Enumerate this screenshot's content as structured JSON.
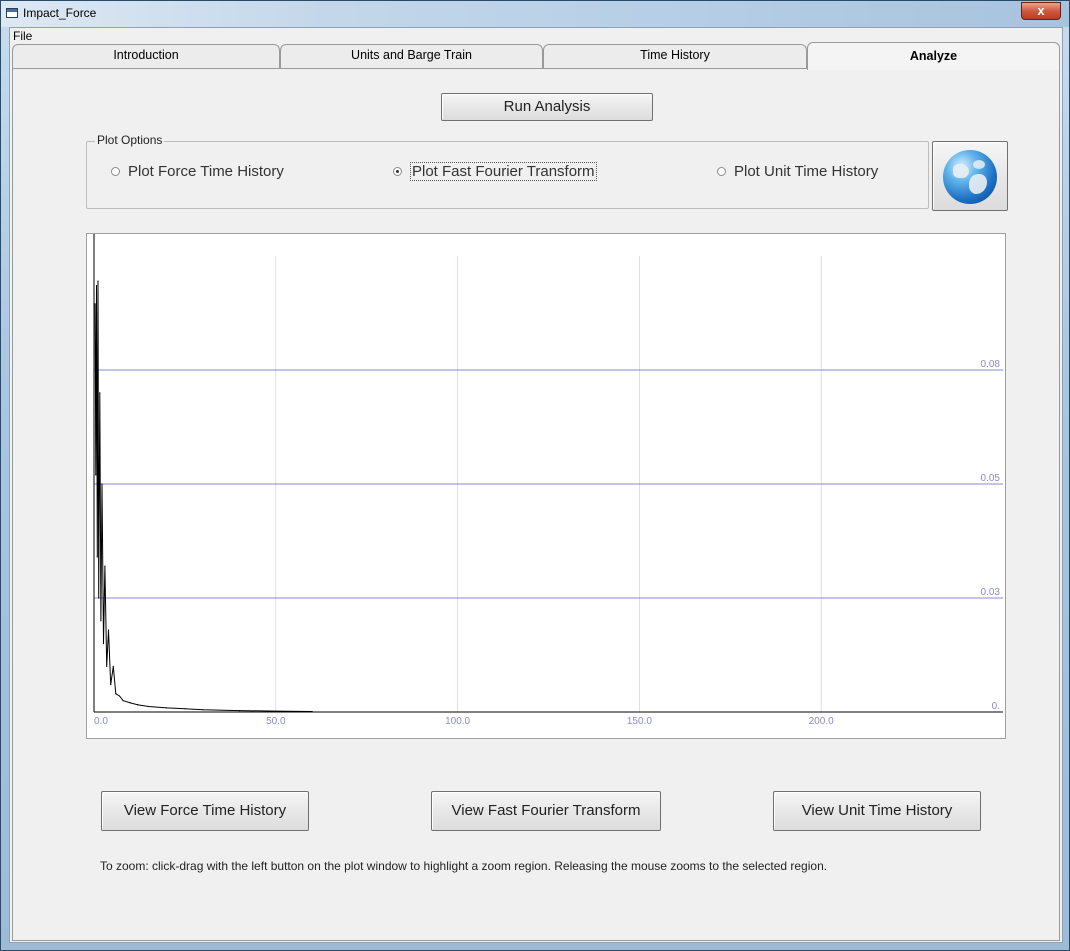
{
  "window": {
    "title": "Impact_Force",
    "close_label": "x"
  },
  "menu": {
    "file": "File"
  },
  "tabs": [
    {
      "label": "Introduction",
      "active": false
    },
    {
      "label": "Units and Barge Train",
      "active": false
    },
    {
      "label": "Time History",
      "active": false
    },
    {
      "label": "Analyze",
      "active": true
    }
  ],
  "run_button": "Run Analysis",
  "plot_options": {
    "title": "Plot Options",
    "options": [
      {
        "label": "Plot Force Time History",
        "selected": false
      },
      {
        "label": "Plot Fast Fourier Transform",
        "selected": true
      },
      {
        "label": "Plot Unit Time History",
        "selected": false
      }
    ],
    "globe_icon": "globe-icon"
  },
  "view_buttons": {
    "force": "View Force Time History",
    "fft": "View Fast Fourier Transform",
    "unit": "View Unit Time History"
  },
  "zoom_note": "To zoom:  click-drag with the left button on the plot window to highlight a zoom region.  Releasing the mouse zooms to the selected region.",
  "chart_data": {
    "type": "line",
    "title": "",
    "xlabel": "",
    "ylabel": "",
    "xlim": [
      0,
      250
    ],
    "ylim": [
      0,
      0.1
    ],
    "x_ticks": [
      {
        "value": 0,
        "label": "0.0"
      },
      {
        "value": 50,
        "label": "50.0"
      },
      {
        "value": 100,
        "label": "100.0"
      },
      {
        "value": 150,
        "label": "150.0"
      },
      {
        "value": 200,
        "label": "200.0"
      }
    ],
    "y_ticks": [
      {
        "value": 0,
        "label": "0."
      },
      {
        "value": 0.025,
        "label": "0.03"
      },
      {
        "value": 0.05,
        "label": "0.05"
      },
      {
        "value": 0.075,
        "label": "0.08"
      }
    ],
    "grid": true,
    "colors": {
      "line": "#000000",
      "grid": "#8a8ad2",
      "label": "#8a8ad2",
      "axis": "#000000"
    },
    "series": [
      {
        "x": [
          0.3,
          0.5,
          0.7,
          0.9,
          1.1,
          1.3,
          1.6,
          1.9,
          2.2,
          2.6,
          3.0,
          3.5,
          4.0,
          4.6,
          5.3,
          6.0,
          7.0,
          8.0,
          10.0,
          12.0,
          15.0,
          20.0,
          25.0,
          30.0,
          40.0,
          50.0,
          60.0
        ],
        "y": [
          0.0895,
          0.052,
          0.0935,
          0.034,
          0.0945,
          0.025,
          0.07,
          0.02,
          0.05,
          0.015,
          0.032,
          0.01,
          0.018,
          0.006,
          0.01,
          0.004,
          0.0035,
          0.0025,
          0.002,
          0.0016,
          0.0012,
          0.0009,
          0.0007,
          0.0005,
          0.0003,
          0.0002,
          0.0001
        ]
      }
    ]
  }
}
